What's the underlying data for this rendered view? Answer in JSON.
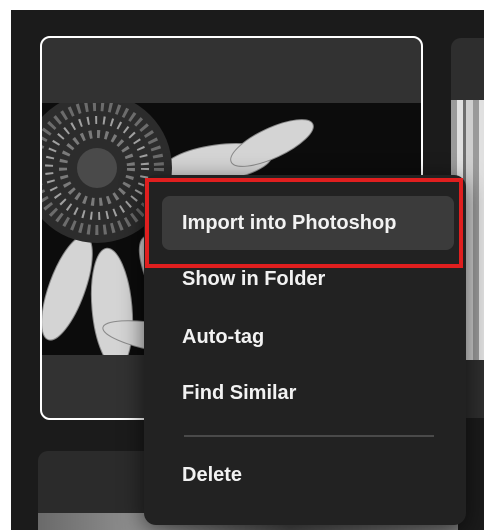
{
  "context_menu": {
    "items": [
      {
        "label": "Import into Photoshop"
      },
      {
        "label": "Show in Folder"
      },
      {
        "label": "Auto-tag"
      },
      {
        "label": "Find Similar"
      },
      {
        "label": "Delete"
      }
    ]
  },
  "colors": {
    "app_background": "#1b1b1b",
    "card_background": "#323232",
    "menu_background": "#222222",
    "active_item_background": "#3b3b3b",
    "highlight": "#e01f1f",
    "text": "#f2f2f2"
  }
}
